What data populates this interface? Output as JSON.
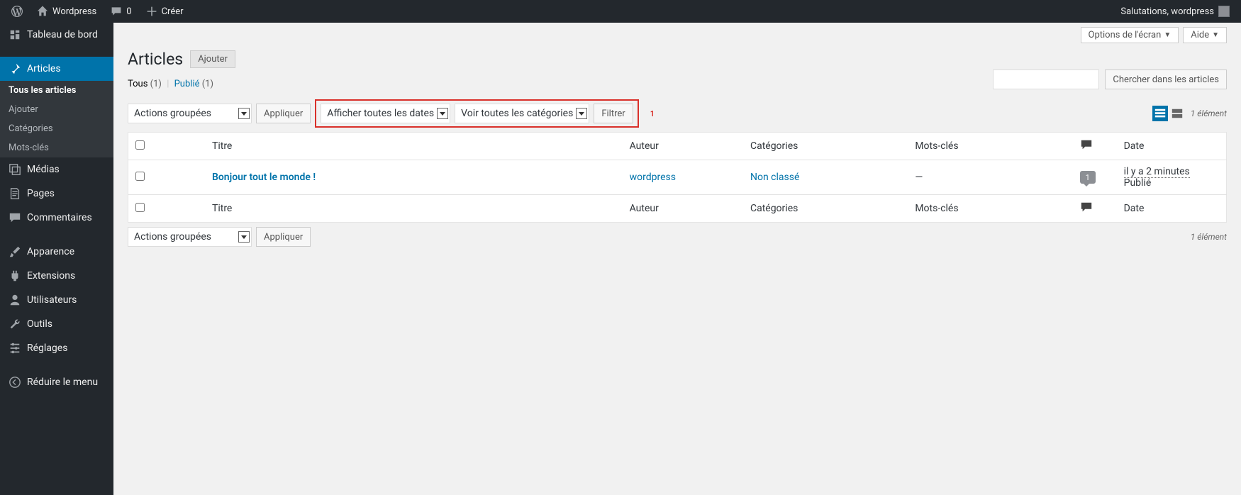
{
  "topbar": {
    "site_name": "Wordpress",
    "comments_count": "0",
    "create_label": "Créer",
    "greeting": "Salutations, wordpress"
  },
  "sidebar": {
    "dashboard": "Tableau de bord",
    "posts": "Articles",
    "posts_sub": {
      "all": "Tous les articles",
      "add": "Ajouter",
      "categories": "Catégories",
      "tags": "Mots-clés"
    },
    "media": "Médias",
    "pages": "Pages",
    "comments": "Commentaires",
    "appearance": "Apparence",
    "plugins": "Extensions",
    "users": "Utilisateurs",
    "tools": "Outils",
    "settings": "Réglages",
    "collapse": "Réduire le menu"
  },
  "screen_opts": {
    "options": "Options de l'écran",
    "help": "Aide"
  },
  "header": {
    "title": "Articles",
    "add": "Ajouter"
  },
  "subsub": {
    "all": "Tous",
    "all_count": "(1)",
    "published": "Publié",
    "published_count": "(1)"
  },
  "filters": {
    "bulk": "Actions groupées",
    "apply": "Appliquer",
    "dates": "Afficher toutes les dates",
    "categories": "Voir toutes les catégories",
    "filter": "Filtrer",
    "annotation": "1",
    "search_btn": "Chercher dans les articles",
    "item_count": "1 élément"
  },
  "columns": {
    "title": "Titre",
    "author": "Auteur",
    "categories": "Catégories",
    "tags": "Mots-clés",
    "date": "Date"
  },
  "rows": [
    {
      "title": "Bonjour tout le monde !",
      "author": "wordpress",
      "category": "Non classé",
      "tags": "—",
      "comments": "1",
      "date_rel": "il y a 2 minutes",
      "date_state": "Publié"
    }
  ]
}
